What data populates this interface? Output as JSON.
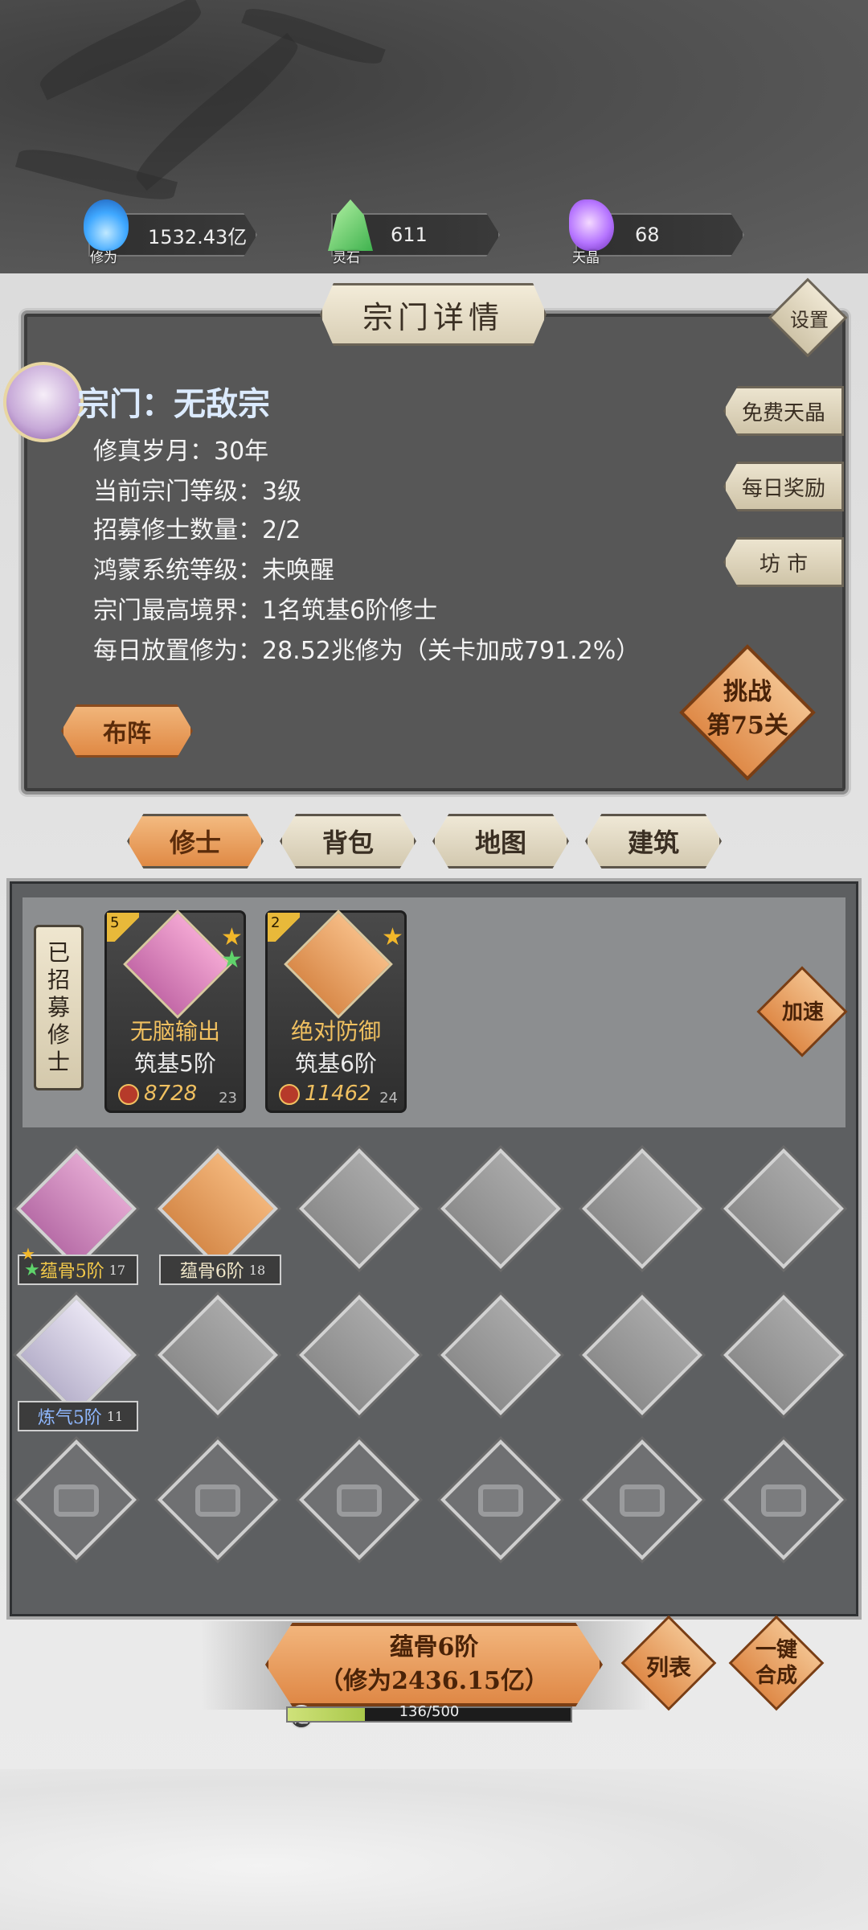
{
  "currencies": [
    {
      "name": "修为",
      "value": "1532.43亿",
      "color": "#3fa8ff"
    },
    {
      "name": "灵石",
      "value": "611",
      "color": "#5fd36b"
    },
    {
      "name": "天晶",
      "value": "68",
      "color": "#b574ff"
    }
  ],
  "panel": {
    "title": "宗门详情",
    "settings_label": "设置",
    "sect_name": "宗门：无敌宗",
    "info_lines": [
      "修真岁月：30年",
      "当前宗门等级：3级",
      "招募修士数量：2/2",
      "鸿蒙系统等级：未唤醒",
      "宗门最高境界：1名筑基6阶修士",
      "每日放置修为：28.52兆修为（关卡加成791.2%）"
    ],
    "side_buttons": [
      "免费天晶",
      "每日奖励",
      "坊 市"
    ],
    "formation_label": "布阵",
    "challenge_label": "挑战",
    "challenge_stage": "第75关"
  },
  "tabs": [
    "修士",
    "背包",
    "地图",
    "建筑"
  ],
  "active_tab": "修士",
  "recruited": {
    "label": "已招募修士",
    "speed_label": "加速",
    "cards": [
      {
        "level": "5",
        "name": "无脑输出",
        "realm": "筑基5阶",
        "power": "8728",
        "count": "23"
      },
      {
        "level": "2",
        "name": "绝对防御",
        "realm": "筑基6阶",
        "power": "11462",
        "count": "24"
      }
    ]
  },
  "grid_tags": [
    {
      "text": "蕴骨5阶",
      "count": "17",
      "color": "#f2c84a"
    },
    {
      "text": "蕴骨6阶",
      "count": "18",
      "color": "#f0e6c8"
    },
    {
      "text": "炼气5阶",
      "count": "11",
      "color": "#8fb8ff"
    }
  ],
  "bottom": {
    "merge_line1": "蕴骨6阶",
    "merge_line2": "（修为2436.15亿）",
    "list_label": "列表",
    "auto_merge_label": "一键合成",
    "luck_icon": "运",
    "luck_text": "136/500",
    "luck_progress": 0.272
  }
}
